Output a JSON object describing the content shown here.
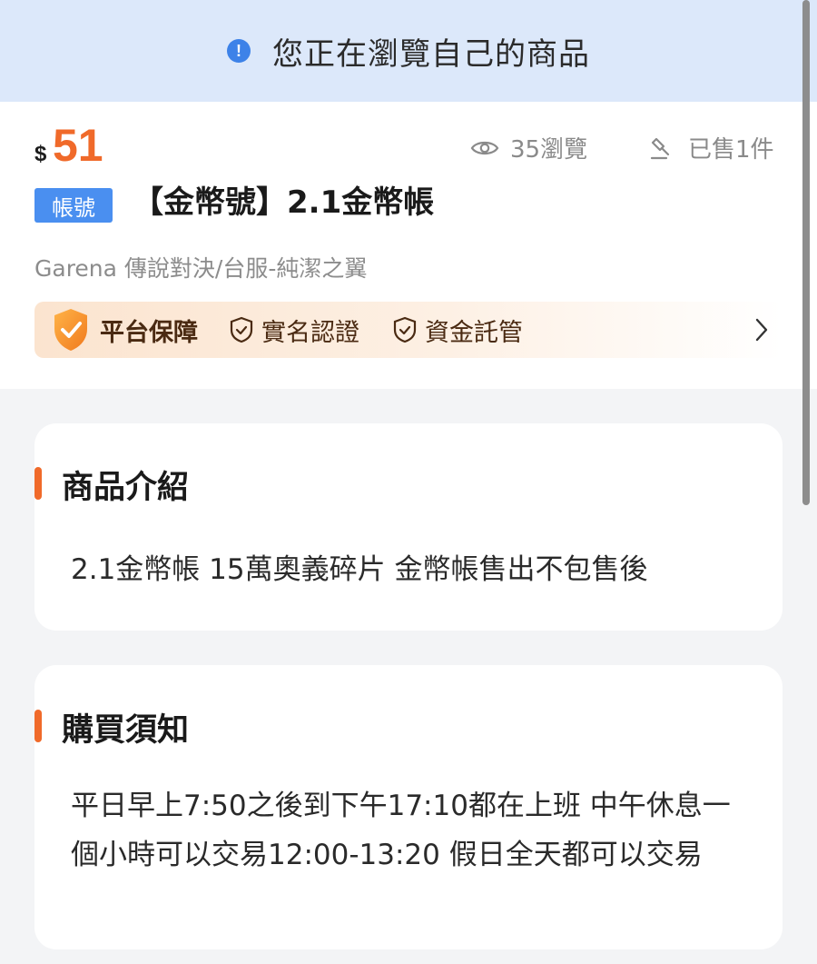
{
  "notice": {
    "icon": "info-icon",
    "text": "您正在瀏覽自己的商品",
    "color": "#dce8fa"
  },
  "product": {
    "currency": "$",
    "price": "51",
    "views": "35瀏覽",
    "sold": "已售1件",
    "type_badge": "帳號",
    "title": "【金幣號】2.1金幣帳",
    "game": "Garena 傳說對決/台服-純潔之翼",
    "price_color": "#f06a2a",
    "badge_color": "#4a8ff0"
  },
  "guarantee": {
    "title": "平台保障",
    "items": [
      "實名認證",
      "資金託管"
    ],
    "icons": [
      "shield-badge-icon",
      "shield-check-icon",
      "chevron-right-icon"
    ]
  },
  "intro": {
    "title": "商品介紹",
    "body": "2.1金幣帳 15萬奧義碎片 金幣帳售出不包售後"
  },
  "purchase_notice": {
    "title": "購買須知",
    "body": "平日早上7:50之後到下午17:10都在上班 中午休息一個小時可以交易12:00-13:20 假日全天都可以交易"
  }
}
